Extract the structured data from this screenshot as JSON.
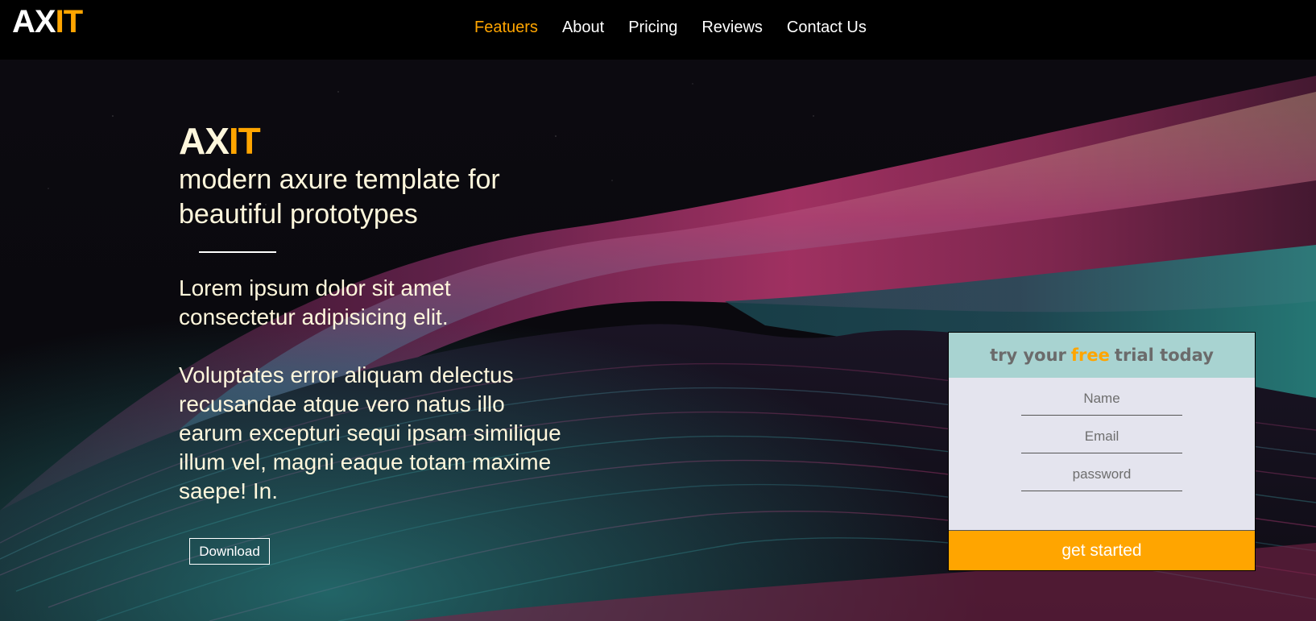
{
  "brand": {
    "part1": "AX",
    "part2": "IT"
  },
  "nav": {
    "items": [
      {
        "label": "Featuers",
        "active": true
      },
      {
        "label": "About",
        "active": false
      },
      {
        "label": "Pricing",
        "active": false
      },
      {
        "label": "Reviews",
        "active": false
      },
      {
        "label": "Contact Us",
        "active": false
      }
    ]
  },
  "hero": {
    "title_part1": "AX",
    "title_part2": "IT",
    "tagline": "modern axure template for beautiful prototypes",
    "paragraph1": "Lorem ipsum dolor sit amet consectetur adipisicing elit.",
    "paragraph2": "Voluptates error aliquam delectus recusandae atque vero natus illo earum excepturi sequi ipsam similique illum vel, magni eaque totam maxime saepe! In.",
    "download_label": "Download"
  },
  "signup": {
    "heading_before": "try your",
    "heading_highlight": "free",
    "heading_after": "trial today",
    "name_placeholder": "Name",
    "email_placeholder": "Email",
    "password_placeholder": "password",
    "submit_label": "get started"
  },
  "colors": {
    "accent": "#ffa500",
    "topbar": "#000000",
    "card_header": "#a8d3d1",
    "card_body": "#e4e4ee",
    "hero_text": "#fff7dc"
  }
}
